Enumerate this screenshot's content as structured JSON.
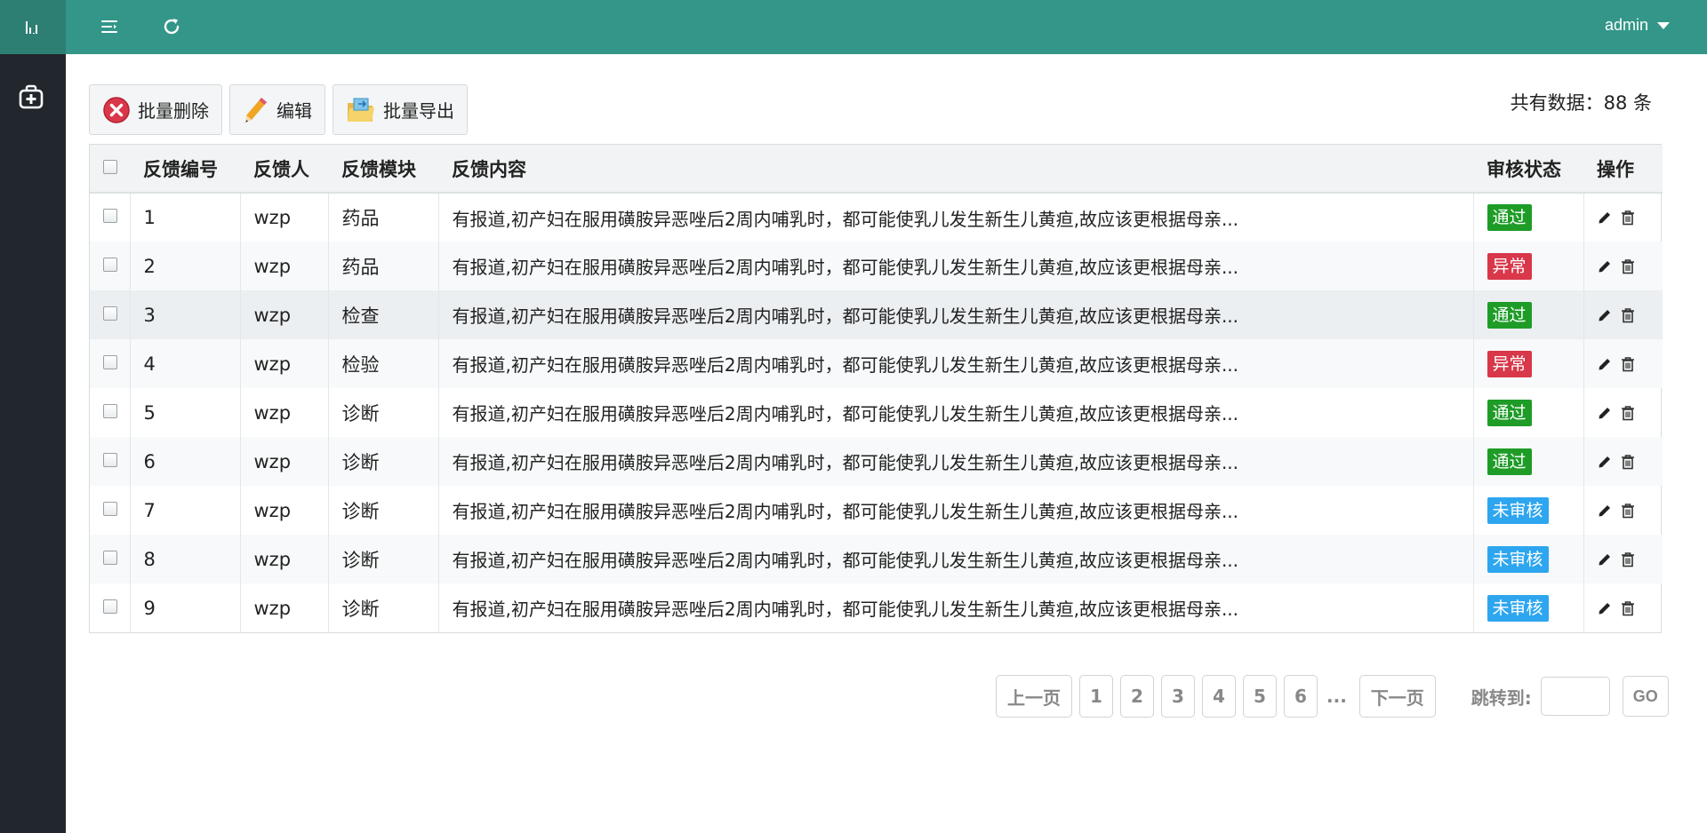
{
  "colors": {
    "accent": "#339688",
    "sidebar": "#22262d",
    "logo_bg": "#2e7f73",
    "status_pass": "#1e9c27",
    "status_abnormal": "#d9374a",
    "status_pending": "#2ea6ef"
  },
  "header": {
    "user": "admin"
  },
  "toolbar": {
    "delete_label": "批量删除",
    "edit_label": "编辑",
    "export_label": "批量导出"
  },
  "total_text": "共有数据：88 条",
  "table": {
    "columns": [
      "反馈编号",
      "反馈人",
      "反馈模块",
      "反馈内容",
      "审核状态",
      "操作"
    ],
    "rows": [
      {
        "id": "1",
        "user": "wzp",
        "module": "药品",
        "content": "有报道,初产妇在服用磺胺异恶唑后2周内哺乳时，都可能使乳儿发生新生儿黄疸,故应该更根据母亲...",
        "status": "通过",
        "status_type": "pass"
      },
      {
        "id": "2",
        "user": "wzp",
        "module": "药品",
        "content": "有报道,初产妇在服用磺胺异恶唑后2周内哺乳时，都可能使乳儿发生新生儿黄疸,故应该更根据母亲...",
        "status": "异常",
        "status_type": "abnormal"
      },
      {
        "id": "3",
        "user": "wzp",
        "module": "检查",
        "content": "有报道,初产妇在服用磺胺异恶唑后2周内哺乳时，都可能使乳儿发生新生儿黄疸,故应该更根据母亲...",
        "status": "通过",
        "status_type": "pass"
      },
      {
        "id": "4",
        "user": "wzp",
        "module": "检验",
        "content": "有报道,初产妇在服用磺胺异恶唑后2周内哺乳时，都可能使乳儿发生新生儿黄疸,故应该更根据母亲...",
        "status": "异常",
        "status_type": "abnormal"
      },
      {
        "id": "5",
        "user": "wzp",
        "module": "诊断",
        "content": "有报道,初产妇在服用磺胺异恶唑后2周内哺乳时，都可能使乳儿发生新生儿黄疸,故应该更根据母亲...",
        "status": "通过",
        "status_type": "pass"
      },
      {
        "id": "6",
        "user": "wzp",
        "module": "诊断",
        "content": "有报道,初产妇在服用磺胺异恶唑后2周内哺乳时，都可能使乳儿发生新生儿黄疸,故应该更根据母亲...",
        "status": "通过",
        "status_type": "pass"
      },
      {
        "id": "7",
        "user": "wzp",
        "module": "诊断",
        "content": "有报道,初产妇在服用磺胺异恶唑后2周内哺乳时，都可能使乳儿发生新生儿黄疸,故应该更根据母亲...",
        "status": "未审核",
        "status_type": "pending"
      },
      {
        "id": "8",
        "user": "wzp",
        "module": "诊断",
        "content": "有报道,初产妇在服用磺胺异恶唑后2周内哺乳时，都可能使乳儿发生新生儿黄疸,故应该更根据母亲...",
        "status": "未审核",
        "status_type": "pending"
      },
      {
        "id": "9",
        "user": "wzp",
        "module": "诊断",
        "content": "有报道,初产妇在服用磺胺异恶唑后2周内哺乳时，都可能使乳儿发生新生儿黄疸,故应该更根据母亲...",
        "status": "未审核",
        "status_type": "pending"
      }
    ]
  },
  "pagination": {
    "prev": "上一页",
    "pages": [
      "1",
      "2",
      "3",
      "4",
      "5",
      "6"
    ],
    "ellipsis": "...",
    "next": "下一页",
    "jump_label": "跳转到:",
    "go": "GO"
  }
}
